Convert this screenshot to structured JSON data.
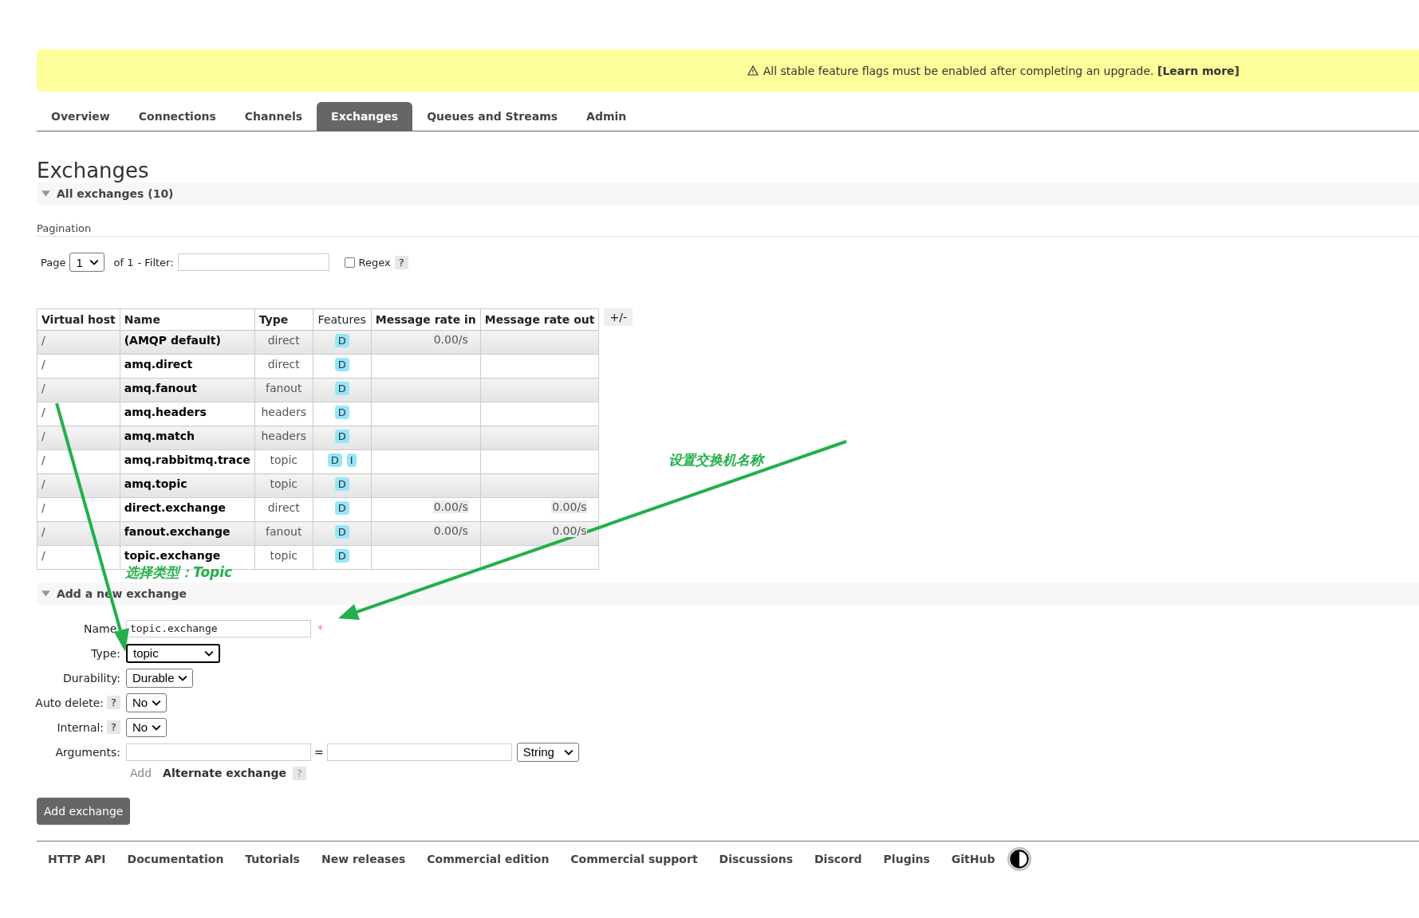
{
  "banner": {
    "text": "All stable feature flags must be enabled after completing an upgrade. **[Learn more]**"
  },
  "tabs": [
    {
      "label": "Overview",
      "selected": false
    },
    {
      "label": "Connections",
      "selected": false
    },
    {
      "label": "Channels",
      "selected": false
    },
    {
      "label": "Exchanges",
      "selected": true
    },
    {
      "label": "Queues and Streams",
      "selected": false
    },
    {
      "label": "Admin",
      "selected": false
    }
  ],
  "page_title": "Exchanges",
  "all_section": {
    "title": "All exchanges (10)",
    "expanded": true
  },
  "pagination": {
    "label": "Pagination",
    "page_label": "Page",
    "page": "1",
    "of": "of 1",
    "filter_label": "- Filter:",
    "regex": {
      "label": "Regex",
      "checked": false
    },
    "help": "?"
  },
  "table": {
    "columns": [
      "Virtual host",
      "Name",
      "Type",
      "Features",
      "Message rate in",
      "Message rate out"
    ],
    "toggle": "+/-",
    "rows": [
      {
        "vhost": "/",
        "name": "(AMQP default)",
        "type": "direct",
        "features": [
          "D"
        ],
        "rate_in": "0.00/s",
        "rate_out": ""
      },
      {
        "vhost": "/",
        "name": "amq.direct",
        "type": "direct",
        "features": [
          "D"
        ],
        "rate_in": "",
        "rate_out": ""
      },
      {
        "vhost": "/",
        "name": "amq.fanout",
        "type": "fanout",
        "features": [
          "D"
        ],
        "rate_in": "",
        "rate_out": ""
      },
      {
        "vhost": "/",
        "name": "amq.headers",
        "type": "headers",
        "features": [
          "D"
        ],
        "rate_in": "",
        "rate_out": ""
      },
      {
        "vhost": "/",
        "name": "amq.match",
        "type": "headers",
        "features": [
          "D"
        ],
        "rate_in": "",
        "rate_out": ""
      },
      {
        "vhost": "/",
        "name": "amq.rabbitmq.trace",
        "type": "topic",
        "features": [
          "D",
          "I"
        ],
        "rate_in": "",
        "rate_out": ""
      },
      {
        "vhost": "/",
        "name": "amq.topic",
        "type": "topic",
        "features": [
          "D"
        ],
        "rate_in": "",
        "rate_out": ""
      },
      {
        "vhost": "/",
        "name": "direct.exchange",
        "type": "direct",
        "features": [
          "D"
        ],
        "rate_in": "0.00/s",
        "rate_out": "0.00/s"
      },
      {
        "vhost": "/",
        "name": "fanout.exchange",
        "type": "fanout",
        "features": [
          "D"
        ],
        "rate_in": "0.00/s",
        "rate_out": "0.00/s"
      },
      {
        "vhost": "/",
        "name": "topic.exchange",
        "type": "topic",
        "features": [
          "D"
        ],
        "rate_in": "",
        "rate_out": ""
      }
    ]
  },
  "add_section": {
    "title": "Add a new exchange",
    "expanded": true
  },
  "form": {
    "name": {
      "label": "Name:",
      "value": "topic.exchange",
      "required": "*"
    },
    "type": {
      "label": "Type:",
      "value": "topic"
    },
    "durability": {
      "label": "Durability:",
      "value": "Durable"
    },
    "auto_delete": {
      "label": "Auto delete:",
      "value": "No",
      "help": "?"
    },
    "internal": {
      "label": "Internal:",
      "value": "No",
      "help": "?"
    },
    "arguments": {
      "label": "Arguments:",
      "equals": "=",
      "value_type": "String",
      "add": "Add",
      "alternate": "Alternate exchange",
      "help": "?"
    },
    "submit": "Add exchange"
  },
  "footer": {
    "links": [
      "HTTP API",
      "Documentation",
      "Tutorials",
      "New releases",
      "Commercial edition",
      "Commercial support",
      "Discussions",
      "Discord",
      "Plugins",
      "GitHub"
    ]
  },
  "annotations": [
    {
      "text": "设置交换机名称",
      "color": "#22b04a"
    },
    {
      "text": "选择类型：Topic",
      "color": "#22b04a"
    }
  ]
}
